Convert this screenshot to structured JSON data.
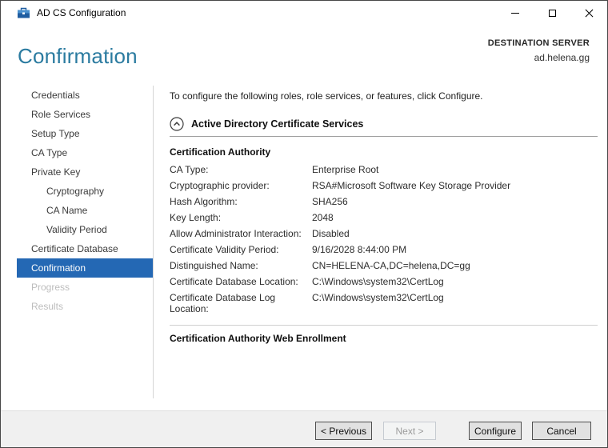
{
  "window": {
    "title": "AD CS Configuration",
    "icons": {
      "app": "server-manager-toolbox",
      "controls": [
        "minimize",
        "maximize",
        "close"
      ]
    }
  },
  "header": {
    "page_title": "Confirmation",
    "destination_label": "DESTINATION SERVER",
    "server_name": "ad.helena.gg"
  },
  "sidebar": {
    "items": [
      {
        "label": "Credentials",
        "state": "enabled",
        "indent": 0
      },
      {
        "label": "Role Services",
        "state": "enabled",
        "indent": 0
      },
      {
        "label": "Setup Type",
        "state": "enabled",
        "indent": 0
      },
      {
        "label": "CA Type",
        "state": "enabled",
        "indent": 0
      },
      {
        "label": "Private Key",
        "state": "enabled",
        "indent": 0
      },
      {
        "label": "Cryptography",
        "state": "enabled",
        "indent": 1
      },
      {
        "label": "CA Name",
        "state": "enabled",
        "indent": 1
      },
      {
        "label": "Validity Period",
        "state": "enabled",
        "indent": 1
      },
      {
        "label": "Certificate Database",
        "state": "enabled",
        "indent": 0
      },
      {
        "label": "Confirmation",
        "state": "selected",
        "indent": 0
      },
      {
        "label": "Progress",
        "state": "disabled",
        "indent": 0
      },
      {
        "label": "Results",
        "state": "disabled",
        "indent": 0
      }
    ]
  },
  "content": {
    "intro": "To configure the following roles, role services, or features, click Configure.",
    "section_title": "Active Directory Certificate Services",
    "collapse_icon": "chevron-up-circle",
    "group1": {
      "title": "Certification Authority",
      "rows": [
        {
          "label": "CA Type:",
          "value": "Enterprise Root"
        },
        {
          "label": "Cryptographic provider:",
          "value": "RSA#Microsoft Software Key Storage Provider"
        },
        {
          "label": "Hash Algorithm:",
          "value": "SHA256"
        },
        {
          "label": "Key Length:",
          "value": "2048"
        },
        {
          "label": "Allow Administrator Interaction:",
          "value": "Disabled"
        },
        {
          "label": "Certificate Validity Period:",
          "value": "9/16/2028 8:44:00 PM"
        },
        {
          "label": "Distinguished Name:",
          "value": "CN=HELENA-CA,DC=helena,DC=gg"
        },
        {
          "label": "Certificate Database Location:",
          "value": "C:\\Windows\\system32\\CertLog"
        },
        {
          "label": "Certificate Database Log Location:",
          "value": "C:\\Windows\\system32\\CertLog"
        }
      ]
    },
    "group2": {
      "title": "Certification Authority Web Enrollment"
    }
  },
  "footer": {
    "buttons": [
      {
        "label": "< Previous",
        "state": "enabled"
      },
      {
        "label": "Next >",
        "state": "disabled"
      },
      {
        "label": "Configure",
        "state": "enabled"
      },
      {
        "label": "Cancel",
        "state": "enabled"
      }
    ]
  },
  "colors": {
    "selection_accent": "#2468b4",
    "page_title": "#2b7ba0",
    "footer_bg": "#f0f0f0",
    "button_bg": "#e1e1e1"
  }
}
